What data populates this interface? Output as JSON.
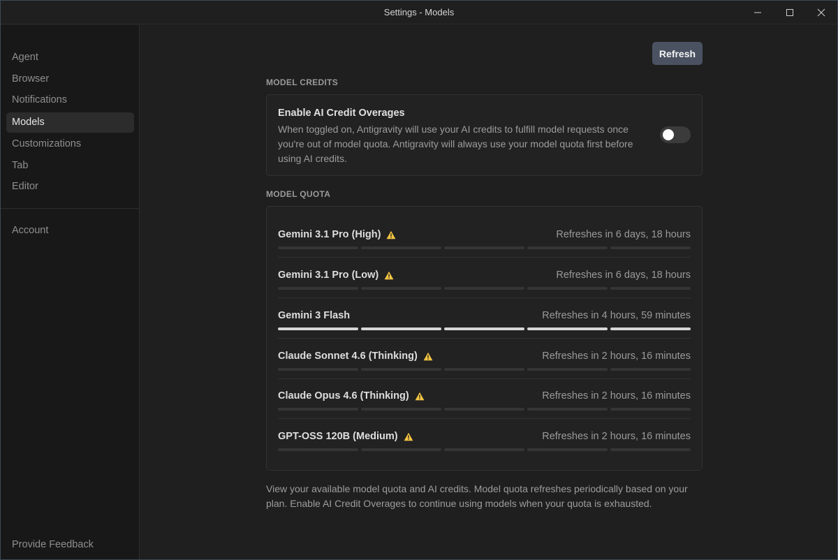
{
  "window": {
    "title": "Settings - Models"
  },
  "sidebar": {
    "items": [
      {
        "label": "Agent"
      },
      {
        "label": "Browser"
      },
      {
        "label": "Notifications"
      },
      {
        "label": "Models",
        "active": true
      },
      {
        "label": "Customizations"
      },
      {
        "label": "Tab"
      },
      {
        "label": "Editor"
      },
      {
        "label": "Account"
      }
    ],
    "feedback_label": "Provide Feedback"
  },
  "main": {
    "refresh_label": "Refresh",
    "credits_section_label": "MODEL CREDITS",
    "credits": {
      "title": "Enable AI Credit Overages",
      "description": "When toggled on, Antigravity will use your AI credits to fulfill model requests once you're out of model quota. Antigravity will always use your model quota first before using AI credits.",
      "enabled": false
    },
    "quota_section_label": "MODEL QUOTA",
    "models": [
      {
        "name": "Gemini 3.1 Pro (High)",
        "warning": true,
        "refresh": "Refreshes in 6 days, 18 hours",
        "quota_fraction": 0
      },
      {
        "name": "Gemini 3.1 Pro (Low)",
        "warning": true,
        "refresh": "Refreshes in 6 days, 18 hours",
        "quota_fraction": 0
      },
      {
        "name": "Gemini 3 Flash",
        "warning": false,
        "refresh": "Refreshes in 4 hours, 59 minutes",
        "quota_fraction": 1
      },
      {
        "name": "Claude Sonnet 4.6 (Thinking)",
        "warning": true,
        "refresh": "Refreshes in 2 hours, 16 minutes",
        "quota_fraction": 0
      },
      {
        "name": "Claude Opus 4.6 (Thinking)",
        "warning": true,
        "refresh": "Refreshes in 2 hours, 16 minutes",
        "quota_fraction": 0
      },
      {
        "name": "GPT-OSS 120B (Medium)",
        "warning": true,
        "refresh": "Refreshes in 2 hours, 16 minutes",
        "quota_fraction": 0
      }
    ],
    "footer_note": "View your available model quota and AI credits. Model quota refreshes periodically based on your plan. Enable AI Credit Overages to continue using models when your quota is exhausted."
  },
  "colors": {
    "warning": "#f5c542",
    "bar_full": "#d6d6d6",
    "bar_empty": "#353535",
    "button_bg": "#4a5262"
  },
  "icons": {
    "minimize": "minimize-icon",
    "maximize": "maximize-icon",
    "close": "close-icon",
    "warning": "warning-icon"
  }
}
